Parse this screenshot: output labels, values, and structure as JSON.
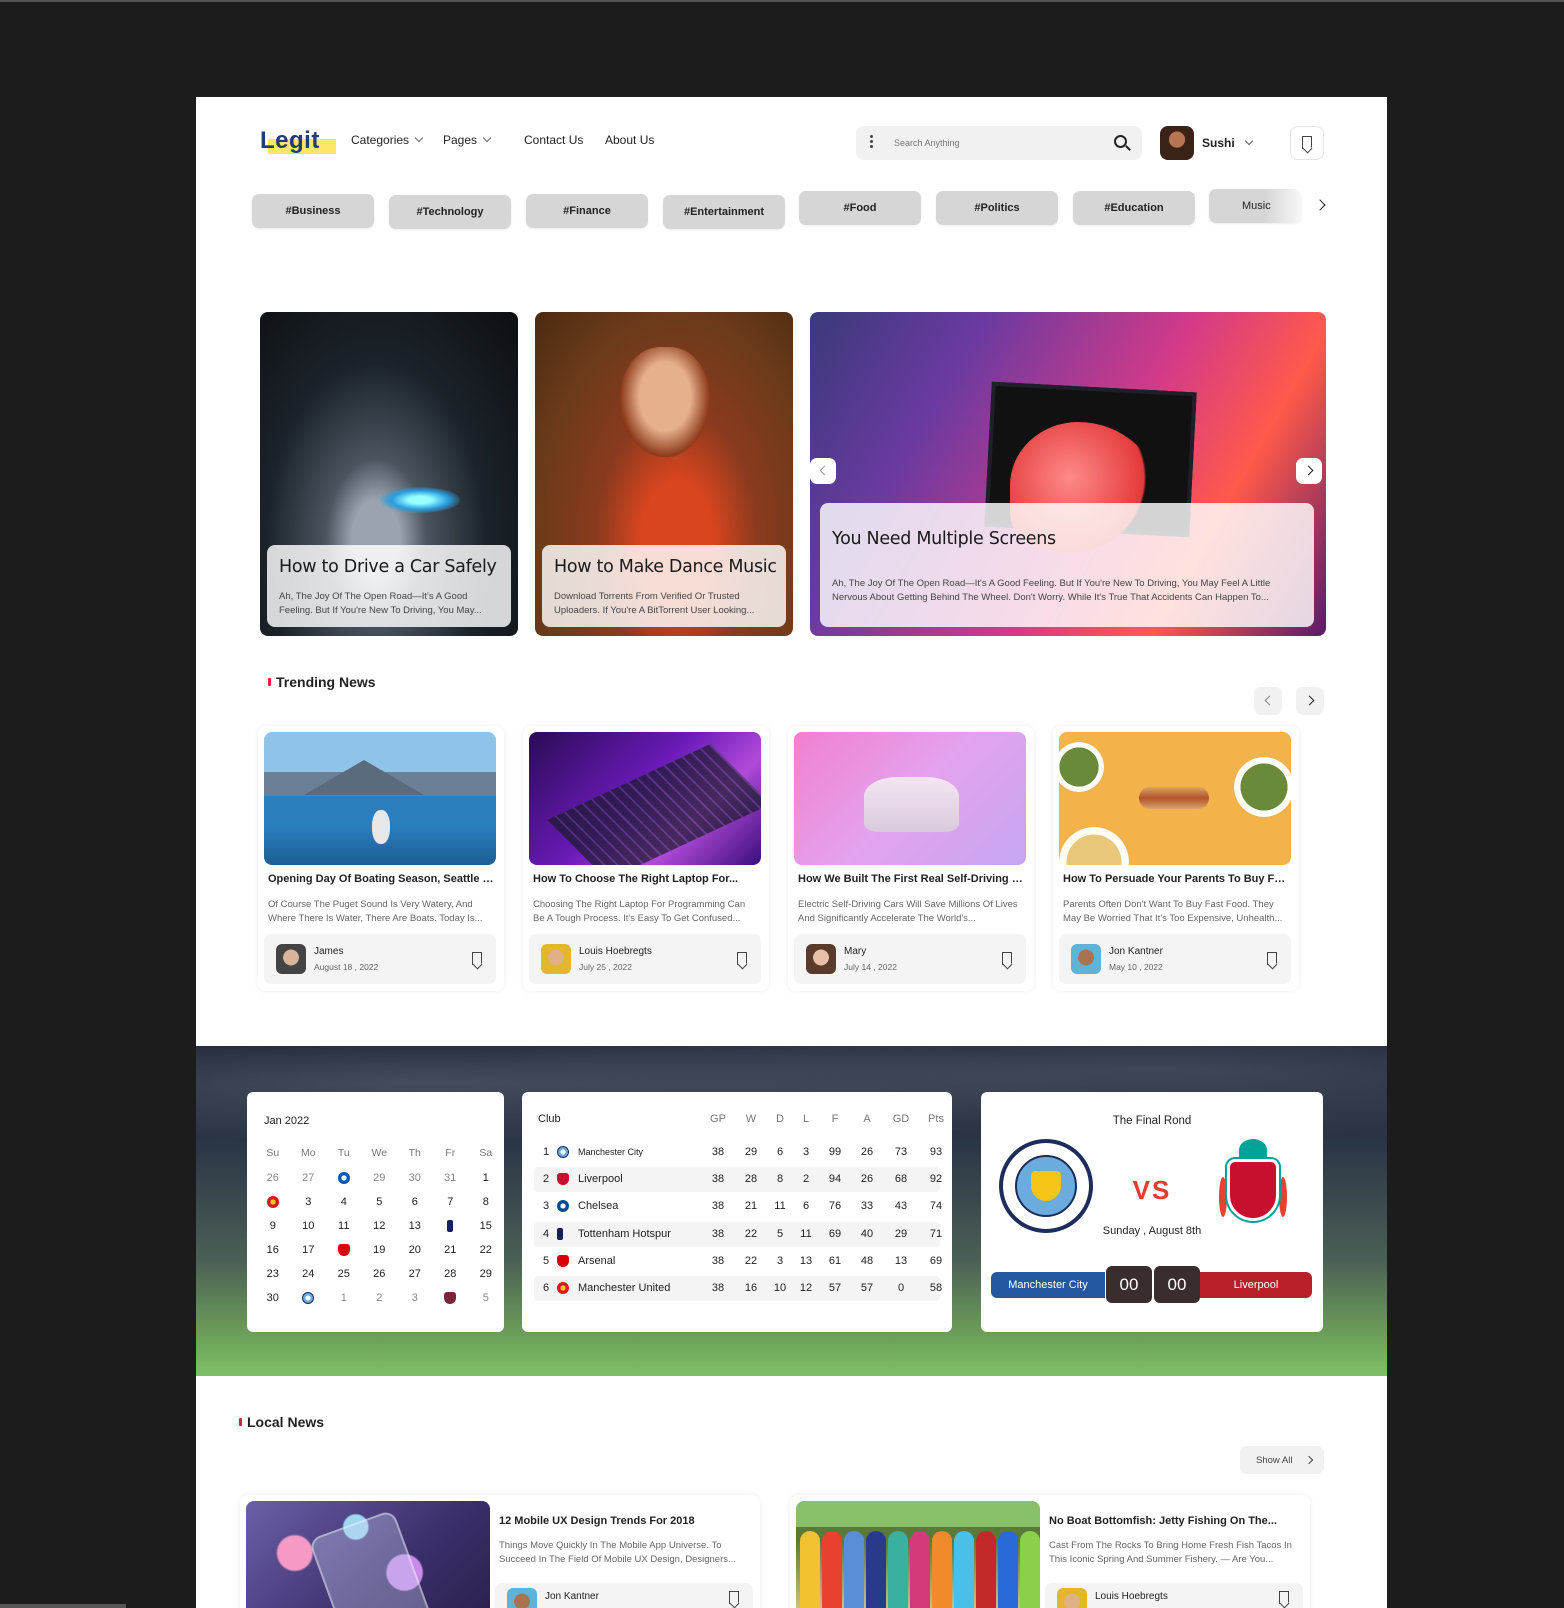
{
  "header": {
    "logo": "Legit",
    "nav": [
      {
        "label": "Categories",
        "dropdown": true
      },
      {
        "label": "Pages",
        "dropdown": true
      },
      {
        "label": "Contact Us",
        "dropdown": false
      },
      {
        "label": "About Us",
        "dropdown": false
      }
    ],
    "search_placeholder": "Search Anything",
    "user_name": "Sushi"
  },
  "tags": [
    "#Business",
    "#Technology",
    "#Finance",
    "#Entertainment",
    "#Food",
    "#Politics",
    "#Education",
    "Music"
  ],
  "hero": [
    {
      "title": "How to Drive a Car Safely",
      "excerpt": "Ah, The Joy Of The Open Road—It's A Good Feeling. But If You're New To Driving, You May..."
    },
    {
      "title": "How to Make Dance Music",
      "excerpt": "Download Torrents From Verified Or Trusted Uploaders. If You're A BitTorrent User Looking..."
    },
    {
      "title": "You Need Multiple Screens",
      "excerpt": "Ah, The Joy Of The Open Road—It's A Good Feeling. But If You're New To Driving, You May Feel A Little Nervous About Getting Behind The Wheel. Don't Worry. While It's True That Accidents Can Happen To..."
    }
  ],
  "trending": {
    "title": "Trending News",
    "cards": [
      {
        "title": "Opening Day Of Boating Season, Seattle WA",
        "excerpt": "Of Course The Puget Sound Is Very Watery, And Where There Is Water, There Are Boats. Today Is...",
        "author": "James",
        "date": "August 18 , 2022"
      },
      {
        "title": "How To Choose The Right Laptop For...",
        "excerpt": "Choosing The Right Laptop For Programming Can Be A Tough Process. It's Easy To Get Confused...",
        "author": "Louis Hoebregts",
        "date": "July 25 , 2022"
      },
      {
        "title": "How We Built The First Real Self-Driving Car",
        "excerpt": "Electric Self-Driving Cars Will Save Millions Of Lives And Significantly Accelerate The World's...",
        "author": "Mary",
        "date": "July 14 , 2022"
      },
      {
        "title": "How To Persuade Your Parents To Buy Fast...",
        "excerpt": "Parents Often Don't Want To Buy Fast Food. They May Be Worried That It's Too Expensive, Unhealth...",
        "author": "Jon Kantner",
        "date": "May 10 , 2022"
      }
    ]
  },
  "calendar": {
    "month": "Jan 2022",
    "weekdays": [
      "Su",
      "Mo",
      "Tu",
      "We",
      "Th",
      "Fr",
      "Sa"
    ],
    "weeks": [
      [
        {
          "d": "26",
          "m": 1
        },
        {
          "d": "27",
          "m": 1
        },
        {
          "b": "b-bha"
        },
        {
          "d": "29",
          "m": 1
        },
        {
          "d": "30",
          "m": 1
        },
        {
          "d": "31",
          "m": 1
        },
        {
          "d": "1"
        }
      ],
      [
        {
          "b": "b-mu"
        },
        {
          "d": "3"
        },
        {
          "d": "4"
        },
        {
          "d": "5"
        },
        {
          "d": "6"
        },
        {
          "d": "7"
        },
        {
          "d": "8"
        }
      ],
      [
        {
          "d": "9"
        },
        {
          "d": "10"
        },
        {
          "d": "11"
        },
        {
          "d": "12"
        },
        {
          "d": "13"
        },
        {
          "b": "b-tot"
        },
        {
          "d": "15"
        }
      ],
      [
        {
          "d": "16"
        },
        {
          "d": "17"
        },
        {
          "b": "b-ars"
        },
        {
          "d": "19"
        },
        {
          "d": "20"
        },
        {
          "d": "21"
        },
        {
          "d": "22"
        }
      ],
      [
        {
          "d": "23"
        },
        {
          "d": "24"
        },
        {
          "d": "25"
        },
        {
          "d": "26"
        },
        {
          "d": "27"
        },
        {
          "d": "28"
        },
        {
          "d": "29"
        }
      ],
      [
        {
          "d": "30"
        },
        {
          "b": "b-mc"
        },
        {
          "d": "1",
          "m": 1
        },
        {
          "d": "2",
          "m": 1
        },
        {
          "d": "3",
          "m": 1
        },
        {
          "b": "b-whu"
        },
        {
          "d": "5",
          "m": 1
        }
      ]
    ]
  },
  "league": {
    "headers": [
      "Club",
      "GP",
      "W",
      "D",
      "L",
      "F",
      "A",
      "GD",
      "Pts"
    ],
    "rows": [
      {
        "pos": "1",
        "club": "Manchester City",
        "badge": "b-mc",
        "gp": "38",
        "w": "29",
        "d": "6",
        "l": "3",
        "f": "99",
        "a": "26",
        "gd": "73",
        "pts": "93"
      },
      {
        "pos": "2",
        "club": "Liverpool",
        "badge": "b-liv",
        "gp": "38",
        "w": "28",
        "d": "8",
        "l": "2",
        "f": "94",
        "a": "26",
        "gd": "68",
        "pts": "92"
      },
      {
        "pos": "3",
        "club": "Chelsea",
        "badge": "b-che",
        "gp": "38",
        "w": "21",
        "d": "11",
        "l": "6",
        "f": "76",
        "a": "33",
        "gd": "43",
        "pts": "74"
      },
      {
        "pos": "4",
        "club": "Tottenham Hotspur",
        "badge": "b-tot",
        "gp": "38",
        "w": "22",
        "d": "5",
        "l": "11",
        "f": "69",
        "a": "40",
        "gd": "29",
        "pts": "71"
      },
      {
        "pos": "5",
        "club": "Arsenal",
        "badge": "b-ars",
        "gp": "38",
        "w": "22",
        "d": "3",
        "l": "13",
        "f": "61",
        "a": "48",
        "gd": "13",
        "pts": "69"
      },
      {
        "pos": "6",
        "club": "Manchester United",
        "badge": "b-mu",
        "gp": "38",
        "w": "16",
        "d": "10",
        "l": "12",
        "f": "57",
        "a": "57",
        "gd": "0",
        "pts": "58"
      }
    ]
  },
  "match": {
    "title": "The Final Rond",
    "vs": "VS",
    "date": "Sunday , August 8th",
    "home": "Manchester City",
    "away": "Liverpool",
    "home_score": "00",
    "away_score": "00",
    "home_color": "#24579f",
    "away_color": "#b8202c"
  },
  "local": {
    "title": "Local News",
    "show_all": "Show All",
    "cards": [
      {
        "title": "12 Mobile UX Design Trends For 2018",
        "excerpt": "Things Move Quickly In The Mobile App Universe. To Succeed In The Field Of Mobile UX Design, Designers...",
        "author": "Jon Kantner"
      },
      {
        "title": "No Boat Bottomfish: Jetty Fishing On The...",
        "excerpt": "Cast From The Rocks To Bring Home Fresh Fish Tacos In This Iconic Spring And Summer Fishery. — Are You...",
        "author": "Louis Hoebregts"
      }
    ]
  },
  "colors": {
    "accent": "#e0203a",
    "brand": "#1f3b78",
    "logo_highlight": "#ffe66b"
  }
}
